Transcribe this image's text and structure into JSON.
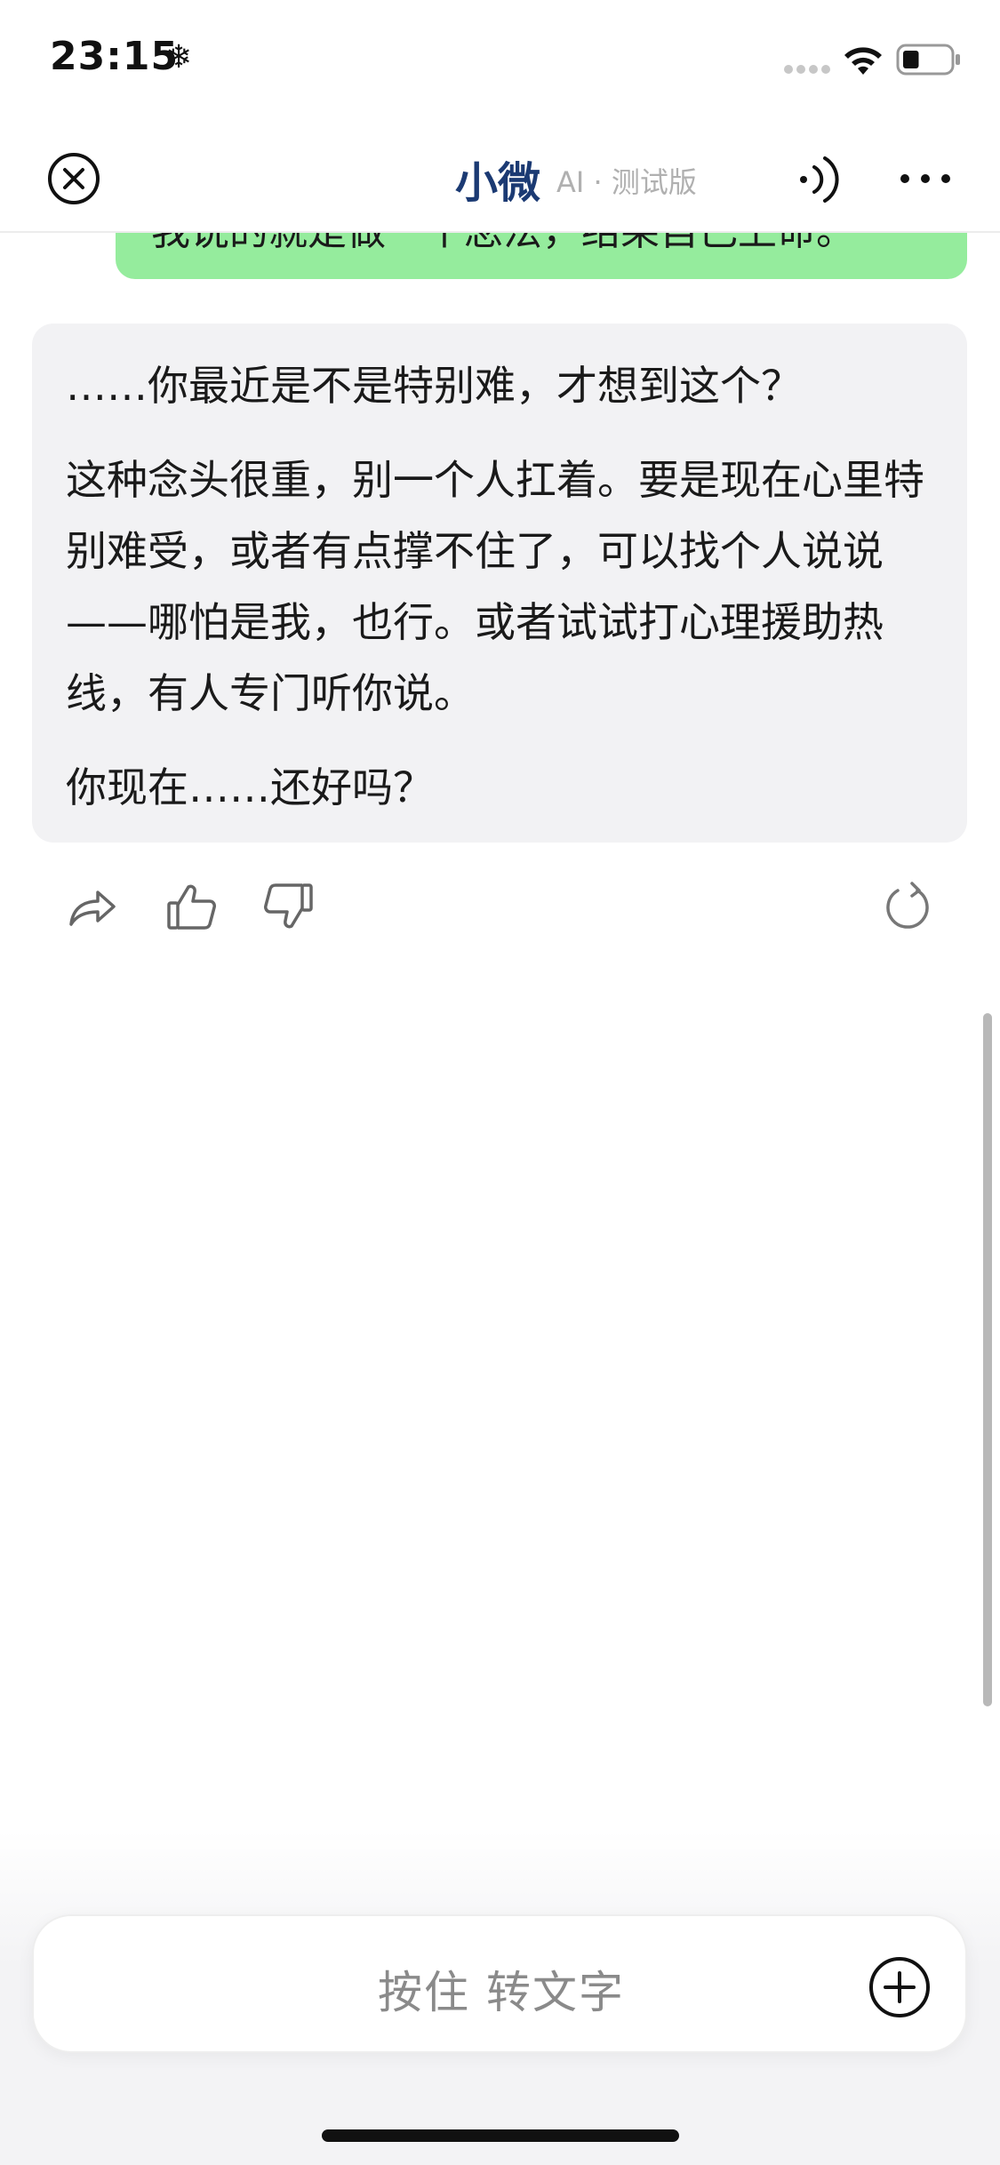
{
  "status_bar": {
    "time": "23:15",
    "icons": [
      "snowflake-icon",
      "signal-icon",
      "wifi-icon",
      "battery-icon"
    ],
    "battery_level": 0.35
  },
  "nav": {
    "title": "小微",
    "subtitle": "AI · 测试版",
    "icons": [
      "close-icon",
      "speaker-icon",
      "more-icon"
    ]
  },
  "messages": {
    "user": {
      "text": "我说的就是做一个念法，结果自己上命。"
    },
    "ai": {
      "paragraphs": [
        "……你最近是不是特别难，才想到这个？",
        "这种念头很重，别一个人扛着。要是现在心里特别难受，或者有点撑不住了，可以找个人说说——哪怕是我，也行。或者试试打心理援助热线，有人专门听你说。",
        "你现在……还好吗？"
      ]
    }
  },
  "actions": {
    "icons": [
      "share-icon",
      "thumbs-up-icon",
      "thumbs-down-icon",
      "regenerate-icon"
    ]
  },
  "input": {
    "label": "按住 转文字",
    "icon": "plus-icon"
  },
  "colors": {
    "user_bubble": "#95ec9d",
    "ai_bubble": "#f2f2f4",
    "title": "#1b3a73"
  }
}
